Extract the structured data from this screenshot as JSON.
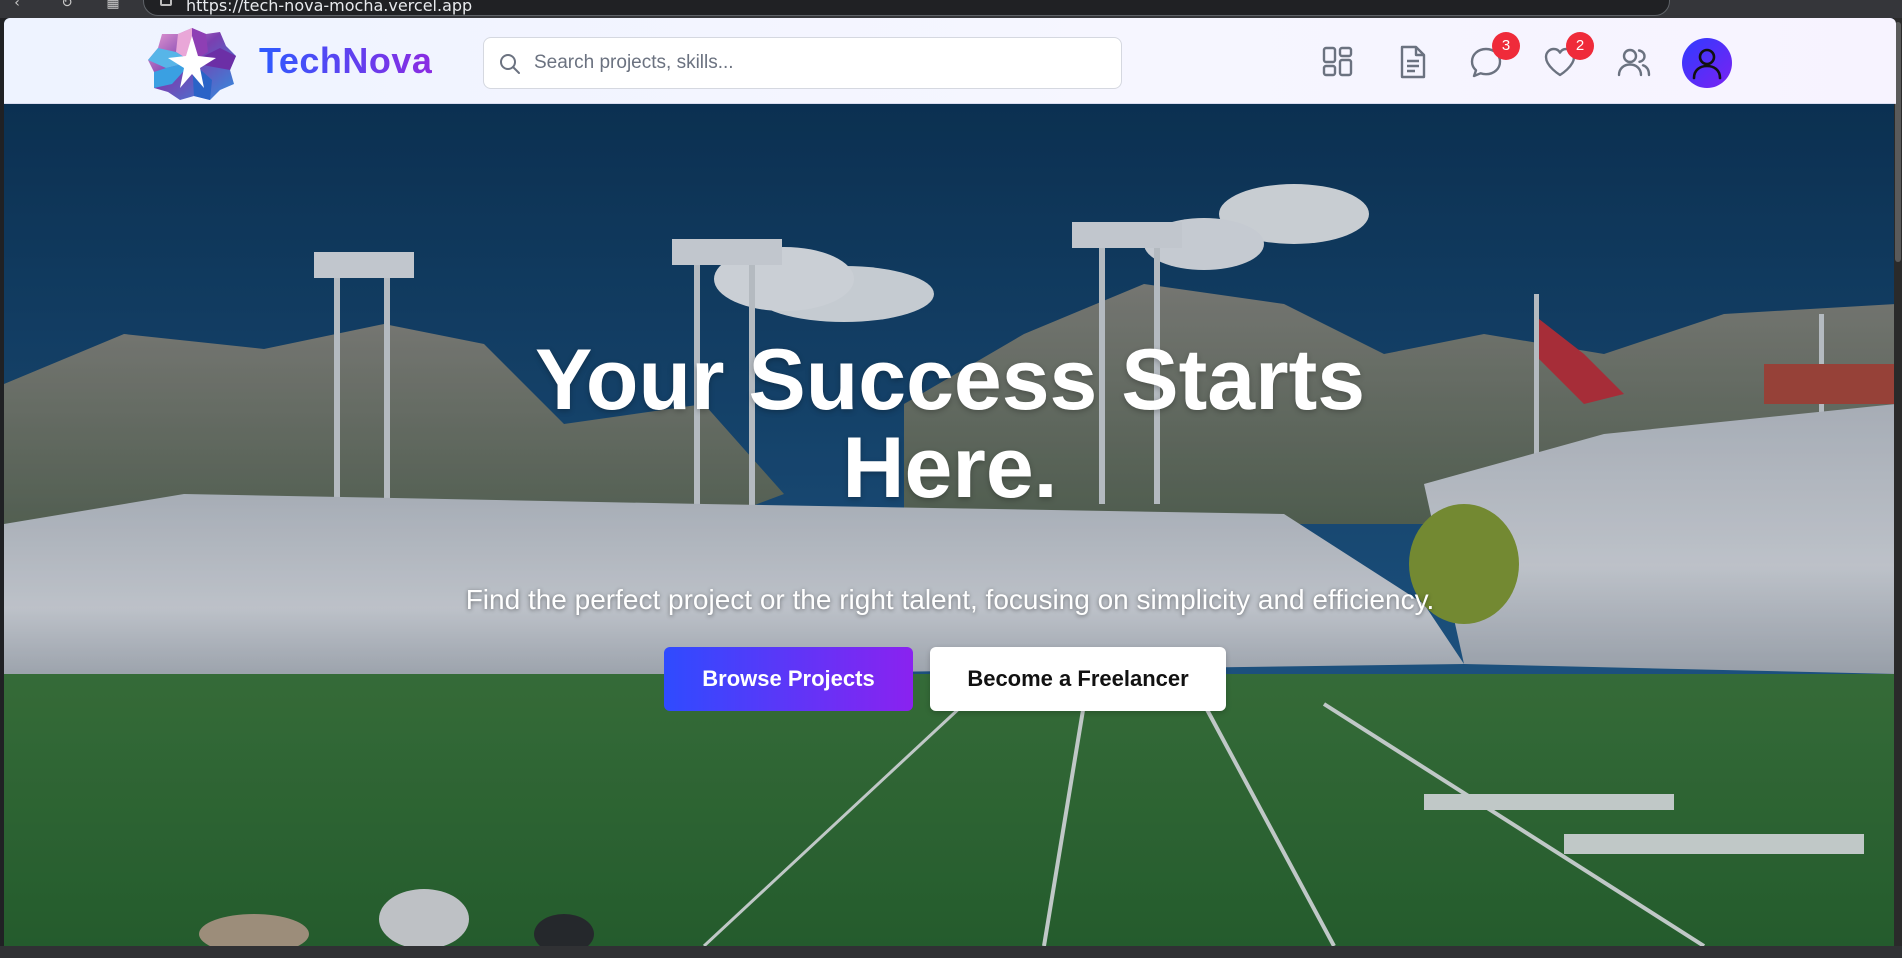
{
  "browser": {
    "url": "https://tech-nova-mocha.vercel.app"
  },
  "header": {
    "brand": "TechNova",
    "search": {
      "placeholder": "Search projects, skills...",
      "value": ""
    },
    "icons": [
      {
        "name": "dashboard-icon"
      },
      {
        "name": "document-icon"
      },
      {
        "name": "messages-icon",
        "badge": "3"
      },
      {
        "name": "favorites-icon",
        "badge": "2"
      },
      {
        "name": "users-icon"
      },
      {
        "name": "profile-avatar-icon"
      }
    ]
  },
  "hero": {
    "title_line1": "Your Success Starts",
    "title_line2": "Here.",
    "subtitle": "Find the perfect project or the right talent, focusing on simplicity and efficiency.",
    "primary_button": "Browse Projects",
    "secondary_button": "Become a Freelancer",
    "background_image": "stadium-crowd-mountains-photo"
  },
  "colors": {
    "brand_gradient_start": "#2d5bff",
    "brand_gradient_end": "#8b2be2",
    "badge": "#ef2b3a",
    "header_bg": "#f3f5ff"
  }
}
